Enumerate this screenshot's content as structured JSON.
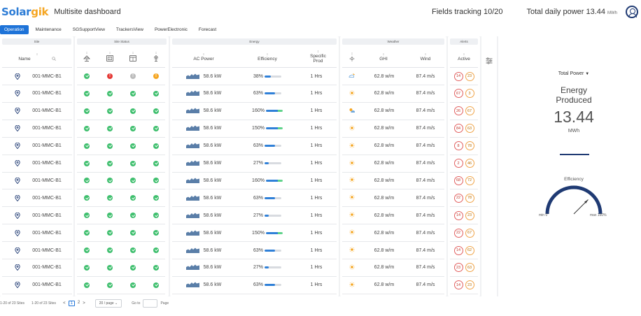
{
  "header": {
    "logo_part1": "Solar",
    "logo_part2": "gik",
    "app_title": "Multisite dashboard",
    "fields_tracking": "Fields tracking 10/20",
    "total_power": "Total daily power 13.44",
    "total_power_unit": "MWh"
  },
  "tabs": [
    {
      "label": "Operation",
      "active": true
    },
    {
      "label": "Maintenance",
      "active": false
    },
    {
      "label": "SGSupportView",
      "active": false
    },
    {
      "label": "TrackersView",
      "active": false
    },
    {
      "label": "PowerElectronic",
      "active": false
    },
    {
      "label": "Forecast",
      "active": false
    }
  ],
  "groups": {
    "site": "Site",
    "site_status": "Site Status",
    "energy": "Energy",
    "weather": "Weather",
    "alerts": "Alerts"
  },
  "columns": {
    "name": "Name",
    "ac_power": "AC Power",
    "efficiency": "Efficiency",
    "specific_prod": "Specific Prod",
    "ghi": "GHI",
    "wind": "Wind",
    "active": "Active",
    "sort_indicator": "↕"
  },
  "status_icons": [
    "tracker-icon",
    "panel-icon",
    "cabinet-icon",
    "tower-icon"
  ],
  "rows": [
    {
      "name": "001-MMC-B1",
      "status": [
        "ok",
        "err",
        "gray",
        "warn"
      ],
      "ac_power": "58.6 kW",
      "efficiency": "38%",
      "eff_pct": 38,
      "specific_prod": "1 Hrs",
      "weather": "cloud-moon-icon",
      "ghi": "62.8 w/m",
      "wind": "87.4 m/s",
      "alerts": [
        "14",
        "23"
      ]
    },
    {
      "name": "001-MMC-B1",
      "status": [
        "ok",
        "ok",
        "ok",
        "ok"
      ],
      "ac_power": "58.6 kW",
      "efficiency": "63%",
      "eff_pct": 63,
      "specific_prod": "1 Hrs",
      "weather": "sun-icon",
      "ghi": "62.8 w/m",
      "wind": "87.4 m/s",
      "alerts": [
        "67",
        "3"
      ]
    },
    {
      "name": "001-MMC-B1",
      "status": [
        "ok",
        "ok",
        "ok",
        "ok"
      ],
      "ac_power": "58.6 kW",
      "efficiency": "160%",
      "eff_pct": 160,
      "specific_prod": "1 Hrs",
      "weather": "sun-cloud-icon",
      "ghi": "62.8 w/m",
      "wind": "87.4 m/s",
      "alerts": [
        "26",
        "67"
      ]
    },
    {
      "name": "001-MMC-B1",
      "status": [
        "ok",
        "ok",
        "ok",
        "ok"
      ],
      "ac_power": "58.6 kW",
      "efficiency": "150%",
      "eff_pct": 150,
      "specific_prod": "1 Hrs",
      "weather": "sun-icon",
      "ghi": "62.8 w/m",
      "wind": "87.4 m/s",
      "alerts": [
        "84",
        "63"
      ]
    },
    {
      "name": "001-MMC-B1",
      "status": [
        "ok",
        "ok",
        "ok",
        "ok"
      ],
      "ac_power": "58.6 kW",
      "efficiency": "63%",
      "eff_pct": 63,
      "specific_prod": "1 Hrs",
      "weather": "sun-icon",
      "ghi": "62.8 w/m",
      "wind": "87.4 m/s",
      "alerts": [
        "8",
        "78"
      ]
    },
    {
      "name": "001-MMC-B1",
      "status": [
        "ok",
        "ok",
        "ok",
        "ok"
      ],
      "ac_power": "58.6 kW",
      "efficiency": "27%",
      "eff_pct": 27,
      "specific_prod": "1 Hrs",
      "weather": "sun-icon",
      "ghi": "62.8 w/m",
      "wind": "87.4 m/s",
      "alerts": [
        "2",
        "46"
      ]
    },
    {
      "name": "001-MMC-B1",
      "status": [
        "ok",
        "ok",
        "ok",
        "ok"
      ],
      "ac_power": "58.6 kW",
      "efficiency": "160%",
      "eff_pct": 160,
      "specific_prod": "1 Hrs",
      "weather": "sun-icon",
      "ghi": "62.8 w/m",
      "wind": "87.4 m/s",
      "alerts": [
        "68",
        "72"
      ]
    },
    {
      "name": "001-MMC-B1",
      "status": [
        "ok",
        "ok",
        "ok",
        "ok"
      ],
      "ac_power": "58.6 kW",
      "efficiency": "63%",
      "eff_pct": 63,
      "specific_prod": "1 Hrs",
      "weather": "sun-icon",
      "ghi": "62.8 w/m",
      "wind": "87.4 m/s",
      "alerts": [
        "22",
        "78"
      ]
    },
    {
      "name": "001-MMC-B1",
      "status": [
        "ok",
        "ok",
        "ok",
        "ok"
      ],
      "ac_power": "58.6 kW",
      "efficiency": "27%",
      "eff_pct": 27,
      "specific_prod": "1 Hrs",
      "weather": "sun-icon",
      "ghi": "62.8 w/m",
      "wind": "87.4 m/s",
      "alerts": [
        "14",
        "23"
      ]
    },
    {
      "name": "001-MMC-B1",
      "status": [
        "ok",
        "ok",
        "ok",
        "ok"
      ],
      "ac_power": "58.6 kW",
      "efficiency": "150%",
      "eff_pct": 150,
      "specific_prod": "1 Hrs",
      "weather": "sun-icon",
      "ghi": "62.8 w/m",
      "wind": "87.4 m/s",
      "alerts": [
        "22",
        "67"
      ]
    },
    {
      "name": "001-MMC-B1",
      "status": [
        "ok",
        "ok",
        "ok",
        "ok"
      ],
      "ac_power": "58.6 kW",
      "efficiency": "63%",
      "eff_pct": 63,
      "specific_prod": "1 Hrs",
      "weather": "sun-icon",
      "ghi": "62.8 w/m",
      "wind": "87.4 m/s",
      "alerts": [
        "14",
        "62"
      ]
    },
    {
      "name": "001-MMC-B1",
      "status": [
        "ok",
        "ok",
        "ok",
        "ok"
      ],
      "ac_power": "58.6 kW",
      "efficiency": "27%",
      "eff_pct": 27,
      "specific_prod": "1 Hrs",
      "weather": "sun-icon",
      "ghi": "62.8 w/m",
      "wind": "87.4 m/s",
      "alerts": [
        "23",
        "63"
      ]
    },
    {
      "name": "001-MMC-B1",
      "status": [
        "ok",
        "ok",
        "ok",
        "ok"
      ],
      "ac_power": "58.6 kW",
      "efficiency": "63%",
      "eff_pct": 63,
      "specific_prod": "1 Hrs",
      "weather": "sun-icon",
      "ghi": "62.8 w/m",
      "wind": "87.4 m/s",
      "alerts": [
        "14",
        "23"
      ]
    }
  ],
  "pagination": {
    "summary1": "1-20 of 23 Sites",
    "summary2": "1-20 of 23 Sites",
    "prev": "<",
    "pages": [
      "1",
      "2"
    ],
    "current": "1",
    "next": ">",
    "page_size": "20 / page",
    "goto_label": "Go to",
    "page_label": "Page"
  },
  "side_panel": {
    "selector": "Total Power",
    "title_line1": "Energy",
    "title_line2": "Produced",
    "value": "13.44",
    "unit": "MWh",
    "gauge_label": "Efficiency",
    "gauge_min": "min 0",
    "gauge_max": "max 160%",
    "gauge_fraction": 0.75
  },
  "colors": {
    "brand_blue": "#2e7dd6",
    "brand_orange": "#f5a623",
    "ok": "#3fbf6e",
    "error": "#e53935",
    "warning": "#f5a623",
    "navy": "#1f3a73"
  }
}
